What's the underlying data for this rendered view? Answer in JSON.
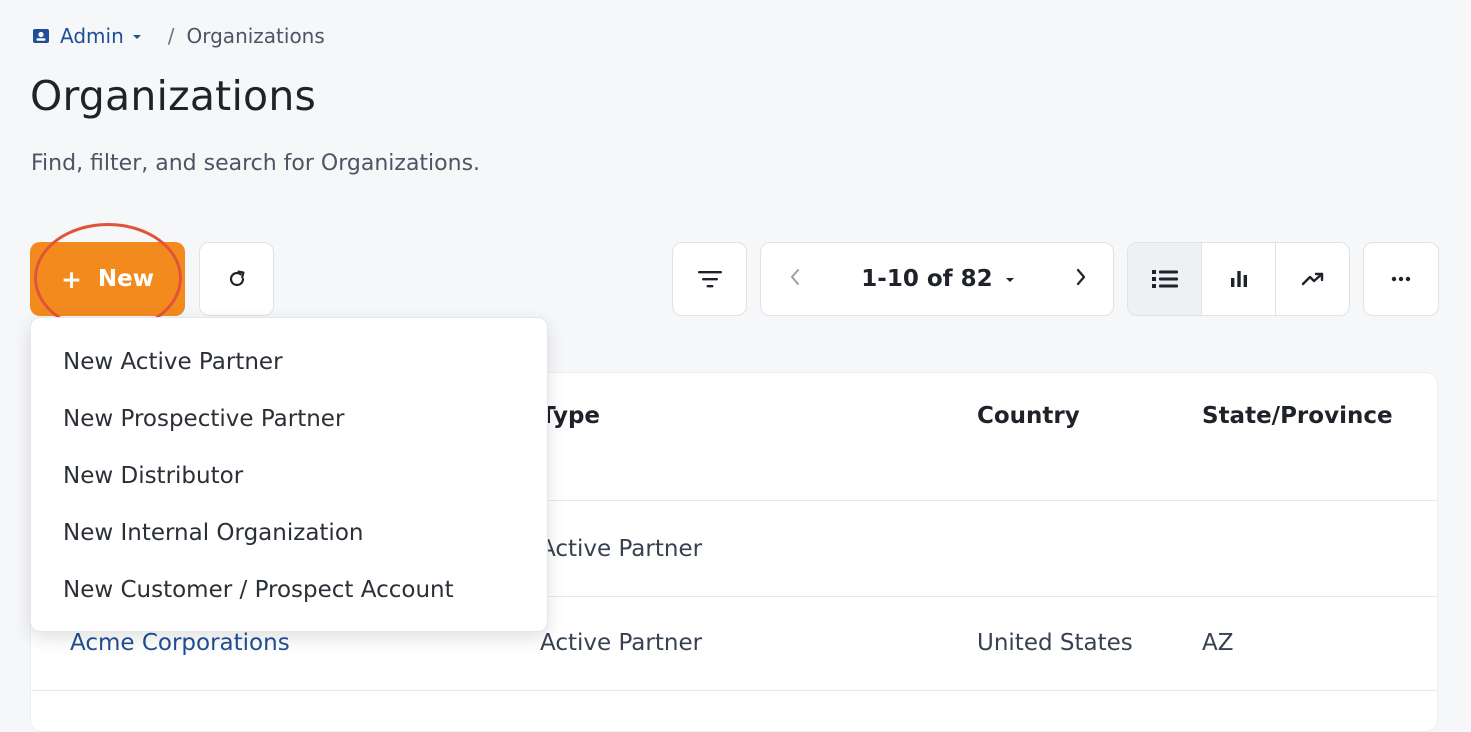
{
  "breadcrumb": {
    "root_label": "Admin",
    "current_label": "Organizations",
    "separator": "/"
  },
  "page": {
    "title": "Organizations",
    "subtitle": "Find, filter, and search for Organizations."
  },
  "toolbar": {
    "new_label": "New",
    "new_plus": "+",
    "pager_label": "1-10 of 82",
    "more_label": "···"
  },
  "new_menu": {
    "items": [
      {
        "label": "New Active Partner"
      },
      {
        "label": "New Prospective Partner"
      },
      {
        "label": "New Distributor"
      },
      {
        "label": "New Internal Organization"
      },
      {
        "label": "New Customer / Prospect Account"
      }
    ]
  },
  "table": {
    "columns": {
      "type": "Type",
      "country": "Country",
      "state": "State/Province"
    },
    "rows": [
      {
        "name": "",
        "type": "Active Partner",
        "country": "",
        "state": ""
      },
      {
        "name": "Acme Corporations",
        "type": "Active Partner",
        "country": "United States",
        "state": "AZ"
      }
    ]
  },
  "colors": {
    "accent": "#f28a1e",
    "link": "#1f4f96",
    "highlight_ring": "#e0553a"
  },
  "icons": {
    "breadcrumb": "contact-card-icon",
    "refresh": "refresh-icon",
    "filter": "filter-icon",
    "prev": "chevron-left-icon",
    "next": "chevron-right-icon",
    "list_view": "list-view-icon",
    "chart_view": "bar-chart-icon",
    "trend_view": "trend-icon",
    "more": "more-icon"
  }
}
